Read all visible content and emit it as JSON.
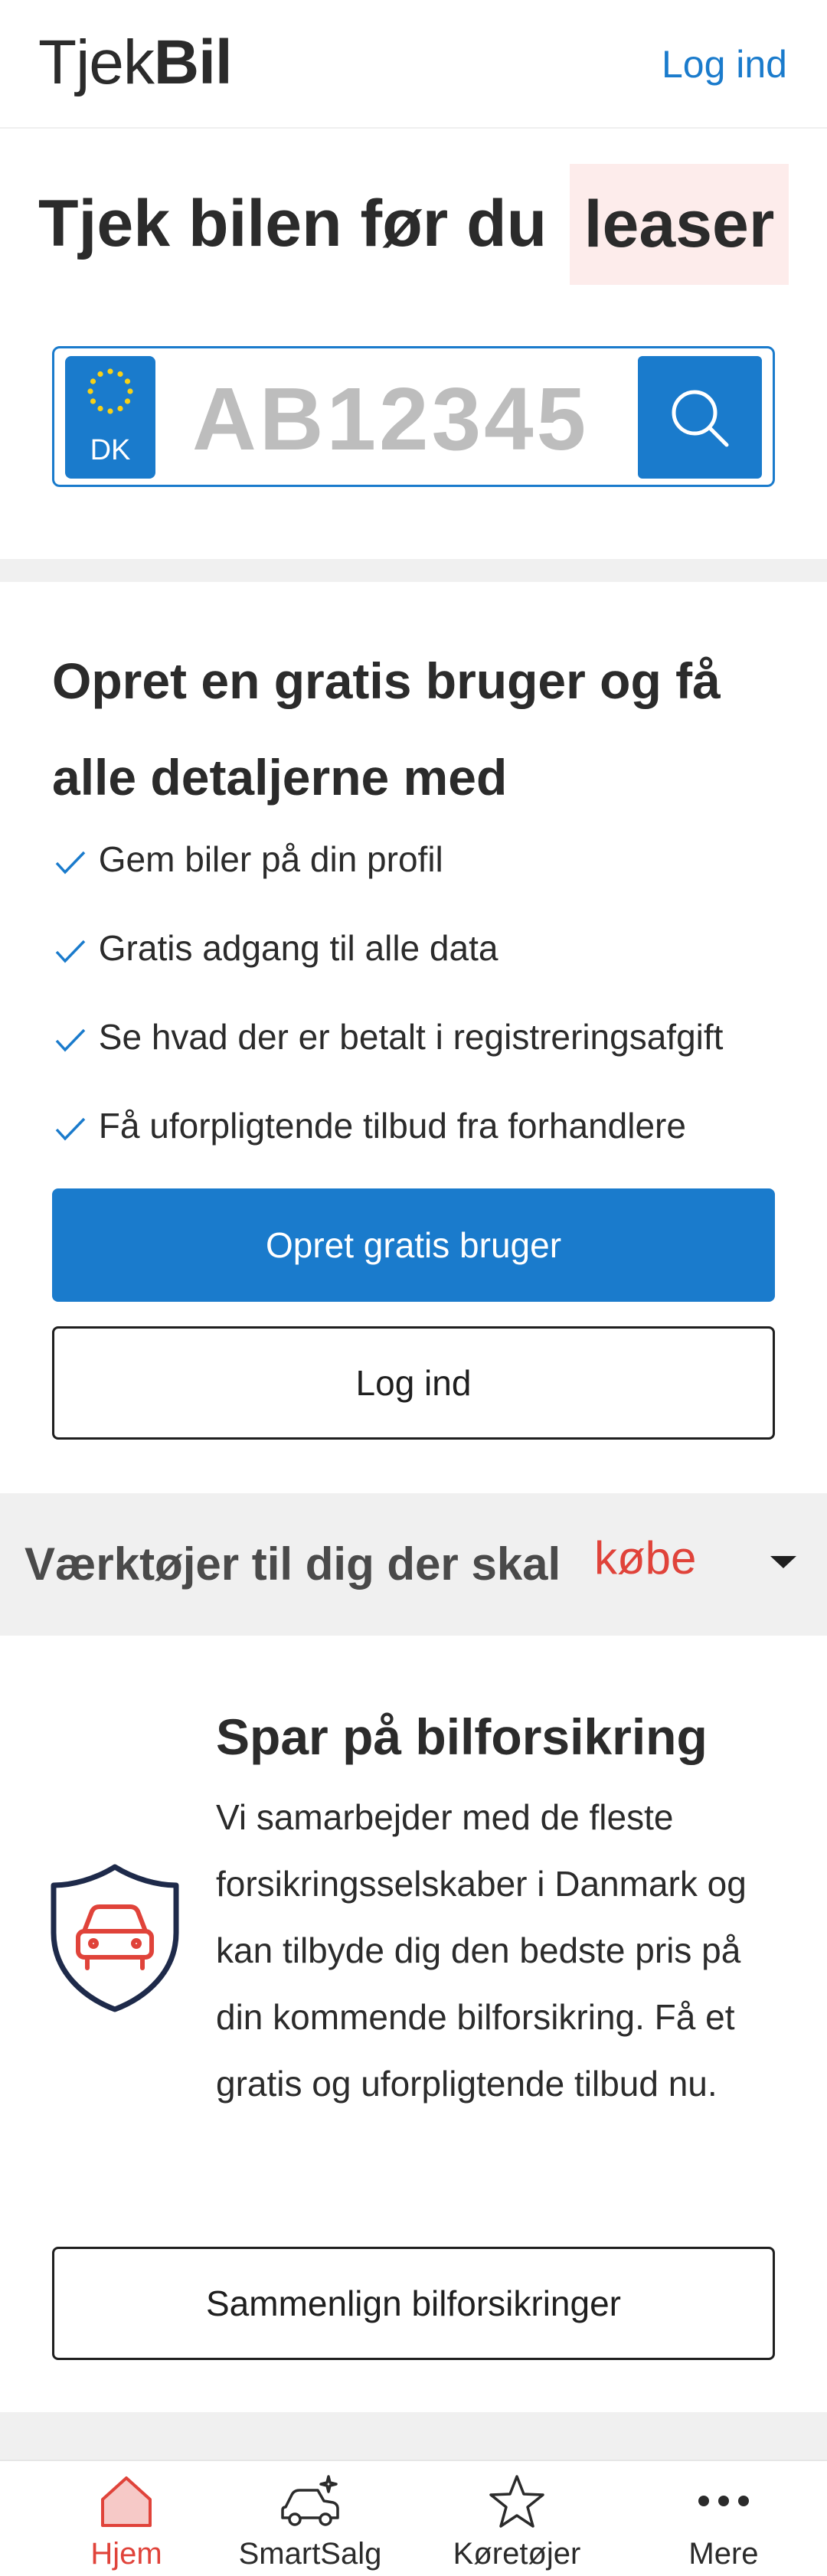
{
  "header": {
    "logo_light": "Tjek",
    "logo_bold": "Bil",
    "login_link": "Log ind"
  },
  "hero": {
    "title": "Tjek bilen før du",
    "rotating_word": "leaser",
    "plate": {
      "country": "DK",
      "placeholder": "AB12345"
    }
  },
  "signup": {
    "title": "Opret en gratis bruger og få alle detaljerne med",
    "benefits": [
      "Gem biler på din profil",
      "Gratis adgang til alle data",
      "Se hvad der er betalt i registreringsafgift",
      "Få uforpligtende tilbud fra forhandlere"
    ],
    "primary_button": "Opret gratis bruger",
    "secondary_button": "Log ind"
  },
  "tools": {
    "text": "Værktøjer til dig der skal",
    "word": "købe"
  },
  "insurance": {
    "title": "Spar på bilforsikring",
    "text": "Vi samarbejder med de fleste forsikringsselskaber i Danmark og kan tilbyde dig den bedste pris på din kommende bilforsikring. Få et gratis og uforpligtende tilbud nu.",
    "button": "Sammenlign bilforsikringer"
  },
  "bottom_nav": [
    {
      "label": "Hjem",
      "icon": "home-icon",
      "active": true
    },
    {
      "label": "SmartSalg",
      "icon": "car-sparkle-icon",
      "active": false
    },
    {
      "label": "Køretøjer",
      "icon": "star-icon",
      "active": false
    },
    {
      "label": "Mere",
      "icon": "more-dots-icon",
      "active": false
    }
  ],
  "colors": {
    "primary": "#1a7bcc",
    "accent": "#e0433a",
    "highlight_bg": "#fdeceb",
    "band_bg": "#f0f0f0",
    "text": "#2b2b2b"
  }
}
